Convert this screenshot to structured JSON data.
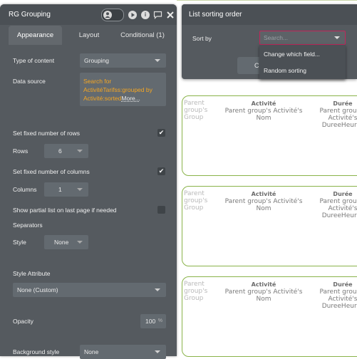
{
  "panel": {
    "title": "RG Grouping",
    "tabs": [
      {
        "label": "Appearance"
      },
      {
        "label": "Layout"
      },
      {
        "label": "Conditional (1)"
      }
    ],
    "type_of_content": {
      "label": "Type of content",
      "value": "Grouping"
    },
    "data_source": {
      "label": "Data source",
      "value": "Search for ActivitéTarifss:grouped by Activité:sorted",
      "more": "More..."
    },
    "fixed_rows": {
      "label": "Set fixed number of rows",
      "checked": true
    },
    "rows": {
      "label": "Rows",
      "value": "6"
    },
    "fixed_cols": {
      "label": "Set fixed number of columns",
      "checked": true
    },
    "columns": {
      "label": "Columns",
      "value": "1"
    },
    "partial_list": {
      "label": "Show partial list on last page if needed",
      "checked": false
    },
    "separators": {
      "label": "Separators"
    },
    "style": {
      "label": "Style",
      "value": "None"
    },
    "style_attribute": {
      "label": "Style Attribute",
      "value": "None (Custom)"
    },
    "opacity": {
      "label": "Opacity",
      "value": "100",
      "unit": "%"
    },
    "background_style": {
      "label": "Background style",
      "value": "None"
    }
  },
  "sort_window": {
    "title": "List sorting order",
    "sort_by_label": "Sort by",
    "search_placeholder": "Search...",
    "menu": [
      "Change which field...",
      "Random sorting"
    ],
    "button_partial": "C"
  },
  "groups": [
    {
      "ghost": "Parent group's Group",
      "col1_header": "Activité",
      "col1_value": "Parent group's Activité's Nom",
      "col2_header": "Durée",
      "col2_value": "Parent group's Activité's DureeHeur H"
    },
    {
      "ghost": "Parent group's Group",
      "col1_header": "Activité",
      "col1_value": "Parent group's Activité's Nom",
      "col2_header": "Durée",
      "col2_value": "Parent group's Activité's DureeHeur H"
    },
    {
      "ghost": "Parent group's Group",
      "col1_header": "Activité",
      "col1_value": "Parent group's Activité's Nom",
      "col2_header": "Durée",
      "col2_value": "Parent group's Activité's DureeHeur H"
    }
  ],
  "colors": {
    "panel_bg": "#555a5f",
    "header_bg": "#4b5055",
    "field_bg": "#636a70",
    "data_source_text": "#f5a623",
    "group_border": "#8ab34a",
    "search_border": "#c0265a"
  }
}
